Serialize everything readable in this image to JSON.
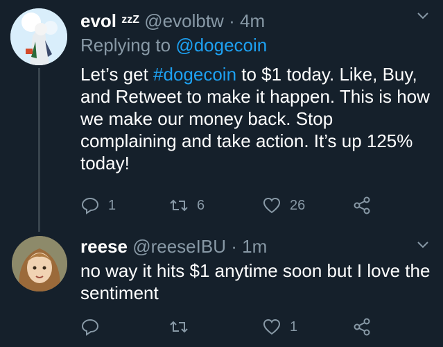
{
  "tweets": [
    {
      "name": "evol",
      "badge": "zzZ",
      "handle": "@evolbtw",
      "separator": "·",
      "time": "4m",
      "replying_prefix": "Replying to",
      "replying_to": "@dogecoin",
      "text_part1": "Let’s get ",
      "hashtag": "#dogecoin",
      "text_part2": " to $1 today. Like, Buy, and Retweet to make it happen. This is how we make our money back. Stop complaining and take action. It’s up 125% today!",
      "actions": {
        "reply": "1",
        "retweet": "6",
        "like": "26",
        "share": ""
      }
    },
    {
      "name": "reese",
      "handle": "@reeseIBU",
      "separator": "·",
      "time": "1m",
      "text": "no way it hits $1 anytime soon but I love the sentiment",
      "actions": {
        "reply": "",
        "retweet": "",
        "like": "1",
        "share": ""
      }
    }
  ],
  "colors": {
    "background": "#15202b",
    "secondary": "#8899a6",
    "link": "#1da1f2",
    "thread": "#38444d"
  },
  "icons": [
    "reply-icon",
    "retweet-icon",
    "like-icon",
    "share-icon",
    "chevron-down-icon"
  ]
}
